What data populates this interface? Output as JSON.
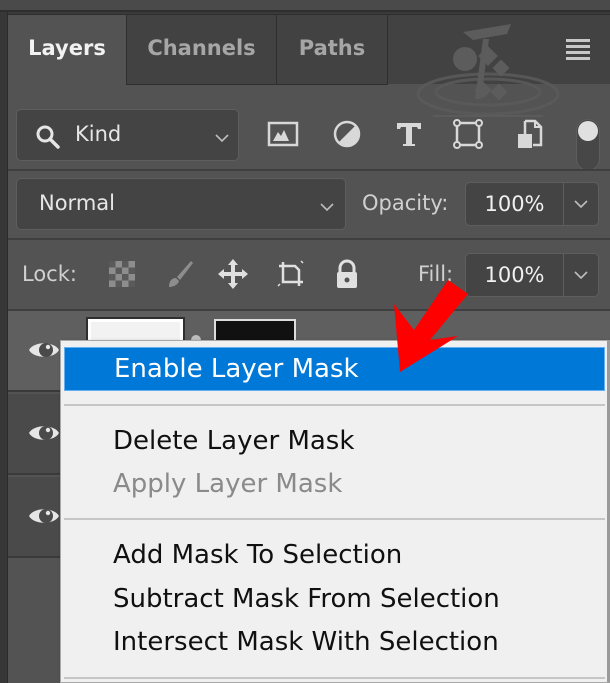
{
  "panel": {
    "tabs": [
      {
        "label": "Layers",
        "active": true
      },
      {
        "label": "Channels",
        "active": false
      },
      {
        "label": "Paths",
        "active": false
      }
    ],
    "menu_icon": "hamburger-menu-icon"
  },
  "filter": {
    "kind_label": "Kind",
    "icons": [
      "pixel-layer-filter-icon",
      "adjustment-layer-filter-icon",
      "type-layer-filter-icon",
      "shape-layer-filter-icon",
      "smart-object-filter-icon"
    ],
    "toggle_state": "on"
  },
  "blend": {
    "mode": "Normal",
    "opacity_label": "Opacity:",
    "opacity_value": "100%"
  },
  "lock": {
    "label": "Lock:",
    "icons": [
      "lock-transparent-pixels-icon",
      "lock-image-pixels-icon",
      "lock-position-icon",
      "lock-artboard-icon",
      "lock-all-icon"
    ],
    "fill_label": "Fill:",
    "fill_value": "100%"
  },
  "layers": [
    {
      "visible": true,
      "selected": true,
      "has_mask": true
    },
    {
      "visible": true,
      "selected": false,
      "has_mask": false
    },
    {
      "visible": true,
      "selected": false,
      "has_mask": false
    }
  ],
  "context_menu": {
    "groups": [
      [
        {
          "label": "Enable Layer Mask",
          "highlighted": true,
          "disabled": false
        }
      ],
      [
        {
          "label": "Delete Layer Mask",
          "highlighted": false,
          "disabled": false
        },
        {
          "label": "Apply Layer Mask",
          "highlighted": false,
          "disabled": true
        }
      ],
      [
        {
          "label": "Add Mask To Selection",
          "highlighted": false,
          "disabled": false
        },
        {
          "label": "Subtract Mask From Selection",
          "highlighted": false,
          "disabled": false
        },
        {
          "label": "Intersect Mask With Selection",
          "highlighted": false,
          "disabled": false
        }
      ]
    ]
  },
  "annotation": {
    "arrow_color": "#ff0000",
    "highlight_color": "#0078d7"
  }
}
